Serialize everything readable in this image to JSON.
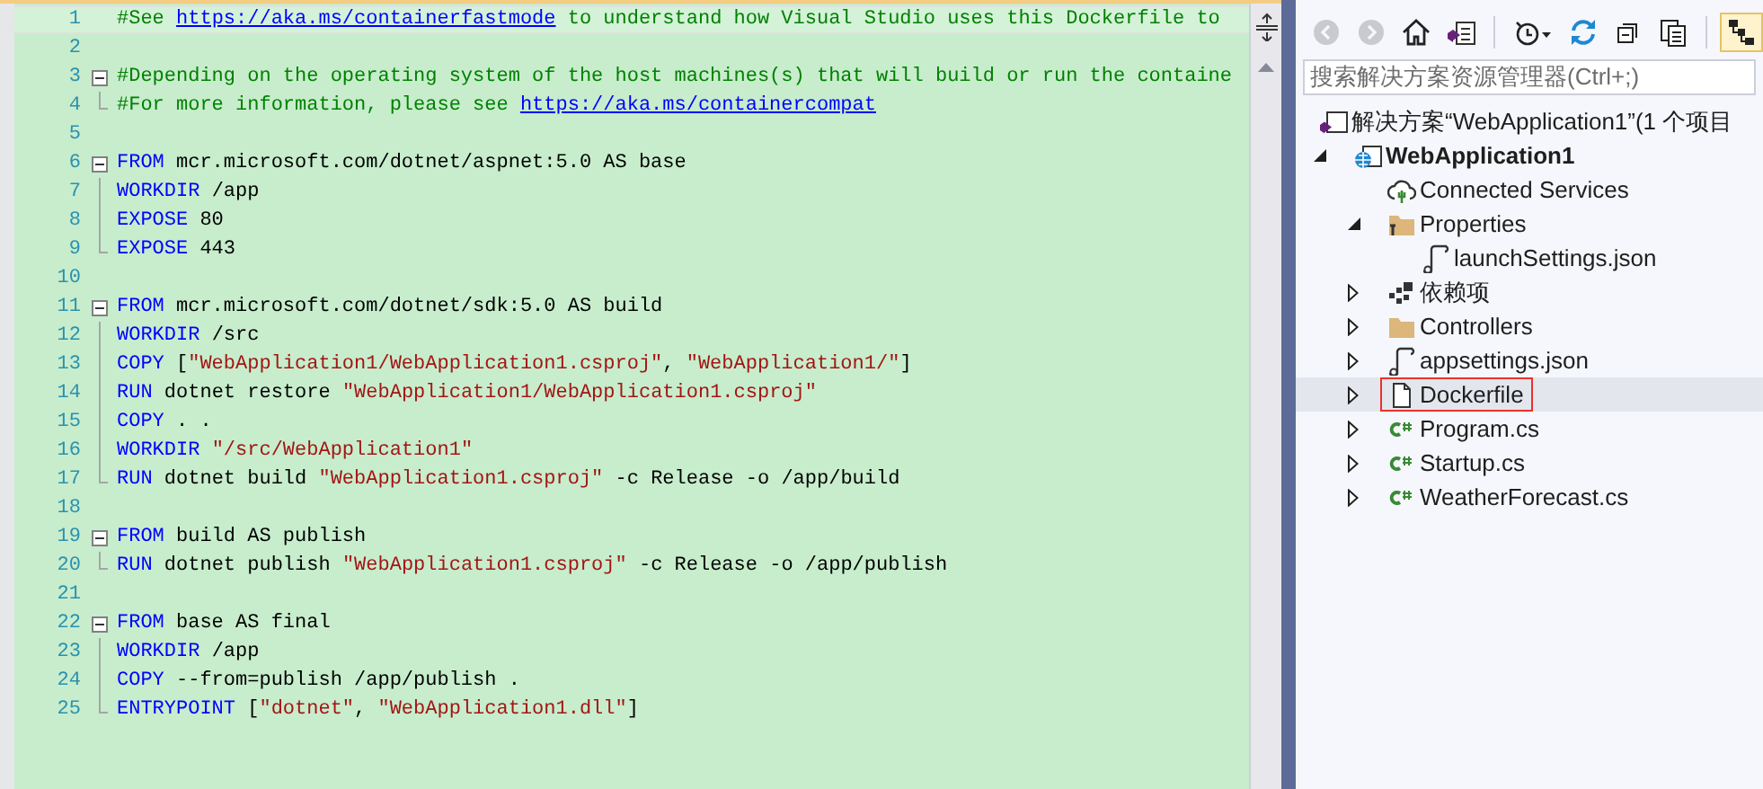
{
  "editor": {
    "lines": [
      {
        "number": "1",
        "fold_start": false,
        "fold_guide": false,
        "fold_end": false,
        "current": true,
        "tokens": [
          {
            "kind": "comment",
            "text": "#See "
          },
          {
            "kind": "link",
            "text": "https://aka.ms/containerfastmode"
          },
          {
            "kind": "comment",
            "text": " to understand how Visual Studio uses this Dockerfile to"
          }
        ]
      },
      {
        "number": "2",
        "fold_start": false,
        "fold_guide": false,
        "fold_end": false,
        "current": false
      },
      {
        "number": "3",
        "fold_start": true,
        "fold_guide": false,
        "fold_end": false,
        "current": false,
        "tokens": [
          {
            "kind": "comment",
            "text": "#Depending on the operating system of the host machines(s) that will build or run the containe"
          }
        ]
      },
      {
        "number": "4",
        "fold_start": false,
        "fold_guide": false,
        "fold_end": true,
        "current": false,
        "tokens": [
          {
            "kind": "comment",
            "text": "#For more information, please see "
          },
          {
            "kind": "link",
            "text": "https://aka.ms/containercompat"
          }
        ]
      },
      {
        "number": "5",
        "fold_start": false,
        "fold_guide": false,
        "fold_end": false,
        "current": false
      },
      {
        "number": "6",
        "fold_start": true,
        "fold_guide": false,
        "fold_end": false,
        "current": false,
        "tokens": [
          {
            "kind": "keyword",
            "text": "FROM"
          },
          {
            "kind": "plain",
            "text": " mcr.microsoft.com/dotnet/aspnet:5.0 AS base"
          }
        ]
      },
      {
        "number": "7",
        "fold_start": false,
        "fold_guide": true,
        "fold_end": false,
        "current": false,
        "tokens": [
          {
            "kind": "keyword",
            "text": "WORKDIR"
          },
          {
            "kind": "plain",
            "text": " /app"
          }
        ]
      },
      {
        "number": "8",
        "fold_start": false,
        "fold_guide": true,
        "fold_end": false,
        "current": false,
        "tokens": [
          {
            "kind": "keyword",
            "text": "EXPOSE"
          },
          {
            "kind": "plain",
            "text": " 80"
          }
        ]
      },
      {
        "number": "9",
        "fold_start": false,
        "fold_guide": false,
        "fold_end": true,
        "current": false,
        "tokens": [
          {
            "kind": "keyword",
            "text": "EXPOSE"
          },
          {
            "kind": "plain",
            "text": " 443"
          }
        ]
      },
      {
        "number": "10",
        "fold_start": false,
        "fold_guide": false,
        "fold_end": false,
        "current": false
      },
      {
        "number": "11",
        "fold_start": true,
        "fold_guide": false,
        "fold_end": false,
        "current": false,
        "tokens": [
          {
            "kind": "keyword",
            "text": "FROM"
          },
          {
            "kind": "plain",
            "text": " mcr.microsoft.com/dotnet/sdk:5.0 AS build"
          }
        ]
      },
      {
        "number": "12",
        "fold_start": false,
        "fold_guide": true,
        "fold_end": false,
        "current": false,
        "tokens": [
          {
            "kind": "keyword",
            "text": "WORKDIR"
          },
          {
            "kind": "plain",
            "text": " /src"
          }
        ]
      },
      {
        "number": "13",
        "fold_start": false,
        "fold_guide": true,
        "fold_end": false,
        "current": false,
        "tokens": [
          {
            "kind": "keyword",
            "text": "COPY"
          },
          {
            "kind": "plain",
            "text": " ["
          },
          {
            "kind": "string",
            "text": "\"WebApplication1/WebApplication1.csproj\""
          },
          {
            "kind": "plain",
            "text": ", "
          },
          {
            "kind": "string",
            "text": "\"WebApplication1/\""
          },
          {
            "kind": "plain",
            "text": "]"
          }
        ]
      },
      {
        "number": "14",
        "fold_start": false,
        "fold_guide": true,
        "fold_end": false,
        "current": false,
        "tokens": [
          {
            "kind": "keyword",
            "text": "RUN"
          },
          {
            "kind": "plain",
            "text": " dotnet restore "
          },
          {
            "kind": "string",
            "text": "\"WebApplication1/WebApplication1.csproj\""
          }
        ]
      },
      {
        "number": "15",
        "fold_start": false,
        "fold_guide": true,
        "fold_end": false,
        "current": false,
        "tokens": [
          {
            "kind": "keyword",
            "text": "COPY"
          },
          {
            "kind": "plain",
            "text": " . ."
          }
        ]
      },
      {
        "number": "16",
        "fold_start": false,
        "fold_guide": true,
        "fold_end": false,
        "current": false,
        "tokens": [
          {
            "kind": "keyword",
            "text": "WORKDIR"
          },
          {
            "kind": "string",
            "text": " \"/src/WebApplication1\""
          }
        ]
      },
      {
        "number": "17",
        "fold_start": false,
        "fold_guide": false,
        "fold_end": true,
        "current": false,
        "tokens": [
          {
            "kind": "keyword",
            "text": "RUN"
          },
          {
            "kind": "plain",
            "text": " dotnet build "
          },
          {
            "kind": "string",
            "text": "\"WebApplication1.csproj\""
          },
          {
            "kind": "plain",
            "text": " -c Release -o /app/build"
          }
        ]
      },
      {
        "number": "18",
        "fold_start": false,
        "fold_guide": false,
        "fold_end": false,
        "current": false
      },
      {
        "number": "19",
        "fold_start": true,
        "fold_guide": false,
        "fold_end": false,
        "current": false,
        "tokens": [
          {
            "kind": "keyword",
            "text": "FROM"
          },
          {
            "kind": "plain",
            "text": " build AS publish"
          }
        ]
      },
      {
        "number": "20",
        "fold_start": false,
        "fold_guide": false,
        "fold_end": true,
        "current": false,
        "tokens": [
          {
            "kind": "keyword",
            "text": "RUN"
          },
          {
            "kind": "plain",
            "text": " dotnet publish "
          },
          {
            "kind": "string",
            "text": "\"WebApplication1.csproj\""
          },
          {
            "kind": "plain",
            "text": " -c Release -o /app/publish"
          }
        ]
      },
      {
        "number": "21",
        "fold_start": false,
        "fold_guide": false,
        "fold_end": false,
        "current": false
      },
      {
        "number": "22",
        "fold_start": true,
        "fold_guide": false,
        "fold_end": false,
        "current": false,
        "tokens": [
          {
            "kind": "keyword",
            "text": "FROM"
          },
          {
            "kind": "plain",
            "text": " base AS final"
          }
        ]
      },
      {
        "number": "23",
        "fold_start": false,
        "fold_guide": true,
        "fold_end": false,
        "current": false,
        "tokens": [
          {
            "kind": "keyword",
            "text": "WORKDIR"
          },
          {
            "kind": "plain",
            "text": " /app"
          }
        ]
      },
      {
        "number": "24",
        "fold_start": false,
        "fold_guide": true,
        "fold_end": false,
        "current": false,
        "tokens": [
          {
            "kind": "keyword",
            "text": "COPY"
          },
          {
            "kind": "plain",
            "text": " --from=publish /app/publish ."
          }
        ]
      },
      {
        "number": "25",
        "fold_start": false,
        "fold_guide": false,
        "fold_end": true,
        "current": false,
        "tokens": [
          {
            "kind": "keyword",
            "text": "ENTRYPOINT"
          },
          {
            "kind": "plain",
            "text": " ["
          },
          {
            "kind": "string",
            "text": "\"dotnet\""
          },
          {
            "kind": "plain",
            "text": ", "
          },
          {
            "kind": "string",
            "text": "\"WebApplication1.dll\""
          },
          {
            "kind": "plain",
            "text": "]"
          }
        ]
      }
    ]
  },
  "solution_explorer": {
    "toolbar": [
      {
        "kind": "back",
        "disabled": true,
        "active": false
      },
      {
        "kind": "forward",
        "disabled": true,
        "active": false
      },
      {
        "kind": "home",
        "disabled": false,
        "active": false
      },
      {
        "kind": "solution",
        "disabled": false,
        "active": false
      },
      {
        "kind": "separator"
      },
      {
        "kind": "history",
        "disabled": false,
        "active": false
      },
      {
        "kind": "sync",
        "disabled": false,
        "active": false
      },
      {
        "kind": "collapse",
        "disabled": false,
        "active": false
      },
      {
        "kind": "copy",
        "disabled": false,
        "active": false
      },
      {
        "kind": "separator"
      },
      {
        "kind": "tree",
        "disabled": false,
        "active": true
      }
    ],
    "search": {
      "placeholder": "搜索解决方案资源管理器(Ctrl+;)"
    },
    "tree": [
      {
        "label": "解决方案“WebApplication1”(1 个项目",
        "kind": "solution",
        "selected": false,
        "marked": false,
        "children": [
          {
            "label": "WebApplication1",
            "kind": "project",
            "expanded": true,
            "bold": true,
            "selected": false,
            "marked": false,
            "children": [
              {
                "label": "Connected Services",
                "kind": "service",
                "selected": false,
                "marked": false
              },
              {
                "label": "Properties",
                "kind": "properties",
                "expanded": true,
                "selected": false,
                "marked": false,
                "children": [
                  {
                    "label": "launchSettings.json",
                    "kind": "json",
                    "selected": false,
                    "marked": false
                  }
                ]
              },
              {
                "label": "依赖项",
                "kind": "dependencies",
                "expanded": false,
                "selected": false,
                "marked": false
              },
              {
                "label": "Controllers",
                "kind": "folder",
                "expanded": false,
                "selected": false,
                "marked": false
              },
              {
                "label": "appsettings.json",
                "kind": "json",
                "expanded": false,
                "selected": false,
                "marked": false
              },
              {
                "label": "Dockerfile",
                "kind": "file",
                "expanded": false,
                "selected": true,
                "marked": true
              },
              {
                "label": "Program.cs",
                "kind": "csharp",
                "expanded": false,
                "selected": false,
                "marked": false
              },
              {
                "label": "Startup.cs",
                "kind": "csharp",
                "expanded": false,
                "selected": false,
                "marked": false
              },
              {
                "label": "WeatherForecast.cs",
                "kind": "csharp",
                "expanded": false,
                "selected": false,
                "marked": false
              }
            ]
          }
        ]
      }
    ]
  }
}
